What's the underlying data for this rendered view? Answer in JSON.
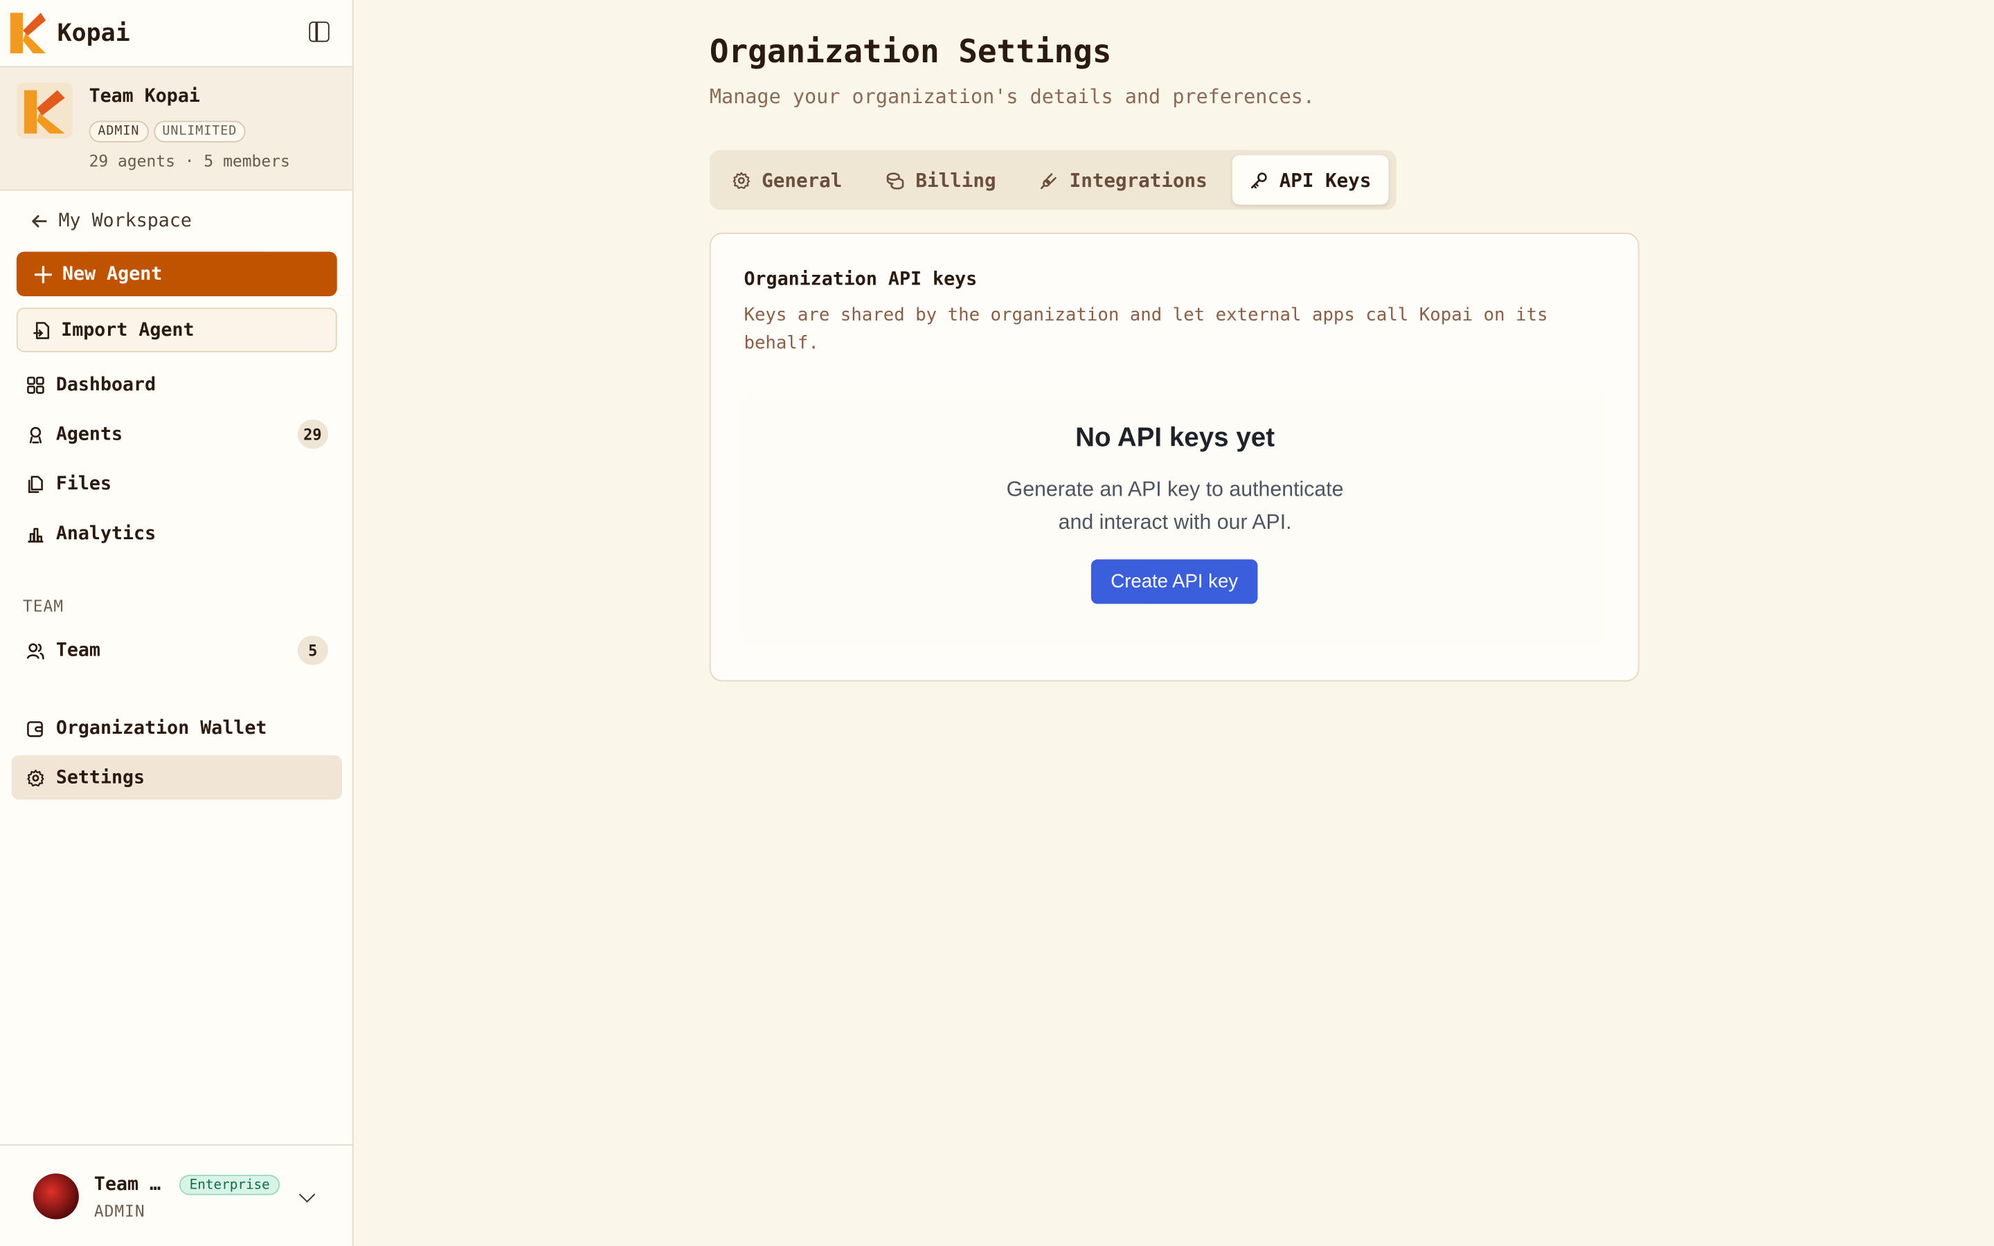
{
  "app": {
    "name": "Kopai"
  },
  "org": {
    "name": "Team Kopai",
    "badges": [
      "ADMIN",
      "UNLIMITED"
    ],
    "meta": "29 agents · 5 members"
  },
  "sidebar": {
    "back_label": "My Workspace",
    "new_agent": "New Agent",
    "import_agent": "Import Agent",
    "items": [
      {
        "label": "Dashboard",
        "icon": "grid-icon"
      },
      {
        "label": "Agents",
        "icon": "robot-icon",
        "count": "29"
      },
      {
        "label": "Files",
        "icon": "files-icon"
      },
      {
        "label": "Analytics",
        "icon": "bar-chart-icon"
      }
    ],
    "team_section": "TEAM",
    "team_item": {
      "label": "Team",
      "icon": "users-icon",
      "count": "5"
    },
    "wallet_item": {
      "label": "Organization Wallet",
      "icon": "wallet-icon"
    },
    "settings_item": {
      "label": "Settings",
      "icon": "gear-icon"
    }
  },
  "user": {
    "name": "Team …",
    "role": "ADMIN",
    "plan": "Enterprise"
  },
  "page": {
    "title": "Organization Settings",
    "subtitle": "Manage your organization's details and preferences."
  },
  "tabs": [
    {
      "label": "General",
      "icon": "gear-icon"
    },
    {
      "label": "Billing",
      "icon": "coins-icon"
    },
    {
      "label": "Integrations",
      "icon": "plug-icon"
    },
    {
      "label": "API Keys",
      "icon": "key-icon",
      "active": true
    }
  ],
  "api_keys": {
    "title": "Organization API keys",
    "description": "Keys are shared by the organization and let external apps call Kopai on its behalf.",
    "empty_title": "No API keys yet",
    "empty_description": "Generate an API key to authenticate and interact with our API.",
    "create_button": "Create API key"
  },
  "colors": {
    "accent": "#bf5300",
    "primary_button": "#3b5fdc",
    "background": "#fbf6ea"
  }
}
